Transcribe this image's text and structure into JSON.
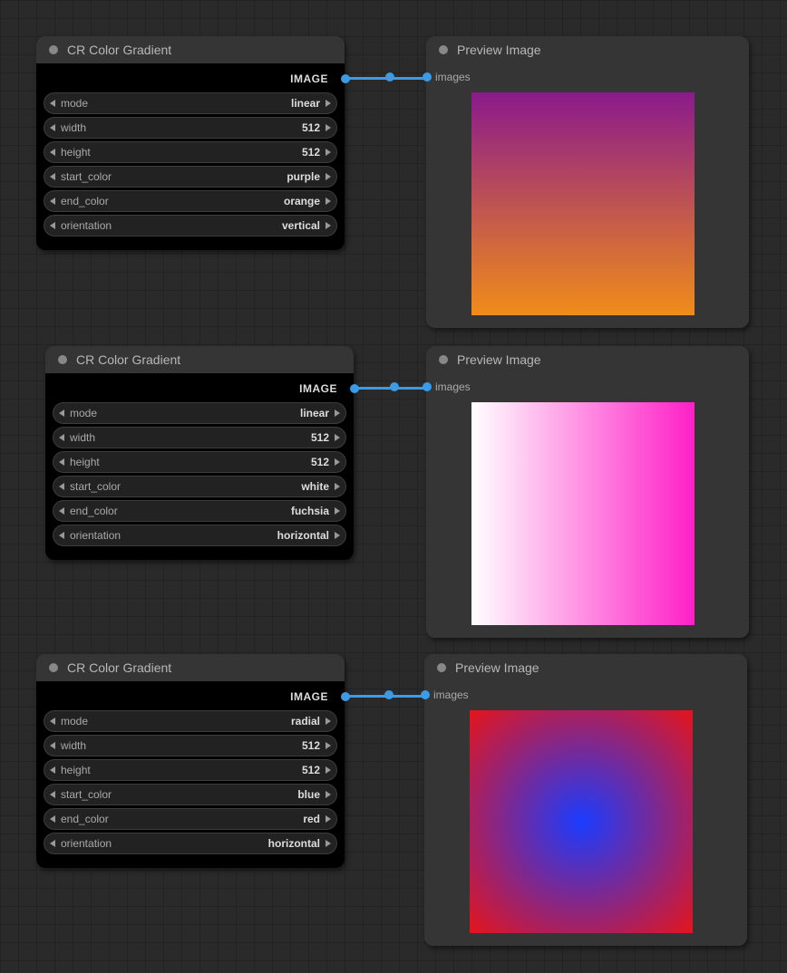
{
  "nodes": [
    {
      "title": "CR Color Gradient",
      "output_label": "IMAGE",
      "widgets": {
        "mode": {
          "label": "mode",
          "value": "linear"
        },
        "width": {
          "label": "width",
          "value": "512"
        },
        "height": {
          "label": "height",
          "value": "512"
        },
        "start_color": {
          "label": "start_color",
          "value": "purple"
        },
        "end_color": {
          "label": "end_color",
          "value": "orange"
        },
        "orientation": {
          "label": "orientation",
          "value": "vertical"
        }
      }
    },
    {
      "title": "CR Color Gradient",
      "output_label": "IMAGE",
      "widgets": {
        "mode": {
          "label": "mode",
          "value": "linear"
        },
        "width": {
          "label": "width",
          "value": "512"
        },
        "height": {
          "label": "height",
          "value": "512"
        },
        "start_color": {
          "label": "start_color",
          "value": "white"
        },
        "end_color": {
          "label": "end_color",
          "value": "fuchsia"
        },
        "orientation": {
          "label": "orientation",
          "value": "horizontal"
        }
      }
    },
    {
      "title": "CR Color Gradient",
      "output_label": "IMAGE",
      "widgets": {
        "mode": {
          "label": "mode",
          "value": "radial"
        },
        "width": {
          "label": "width",
          "value": "512"
        },
        "height": {
          "label": "height",
          "value": "512"
        },
        "start_color": {
          "label": "start_color",
          "value": "blue"
        },
        "end_color": {
          "label": "end_color",
          "value": "red"
        },
        "orientation": {
          "label": "orientation",
          "value": "horizontal"
        }
      }
    }
  ],
  "previews": [
    {
      "title": "Preview Image",
      "input_label": "images"
    },
    {
      "title": "Preview Image",
      "input_label": "images"
    },
    {
      "title": "Preview Image",
      "input_label": "images"
    }
  ],
  "colors": {
    "purple": "#8b1a8b",
    "orange": "#f08c1a",
    "white": "#ffffff",
    "fuchsia": "#ff1fc7",
    "blue": "#1a3cff",
    "red": "#e6141a"
  }
}
